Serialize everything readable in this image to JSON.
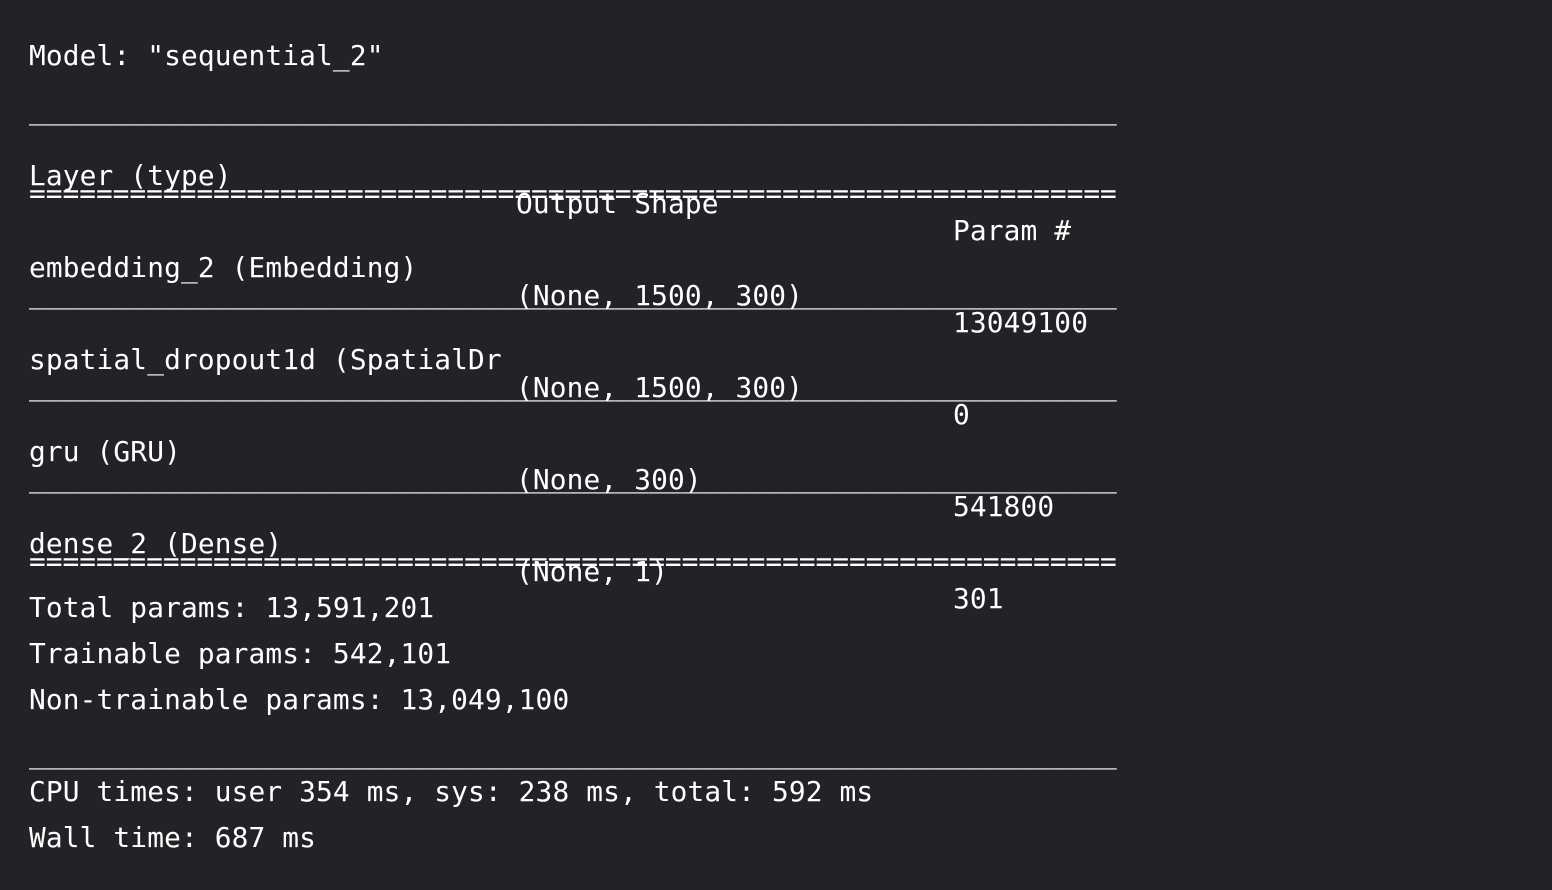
{
  "model_line": "Model: \"sequential_2\"",
  "separators": {
    "dash": "_________________________________________________________________",
    "equals": "================================================================="
  },
  "header": {
    "layer": "Layer (type)",
    "shape": "Output Shape",
    "param": "Param #"
  },
  "layers": [
    {
      "name": "embedding_2 (Embedding)",
      "shape": "(None, 1500, 300)",
      "params": "13049100"
    },
    {
      "name": "spatial_dropout1d (SpatialDr",
      "shape": "(None, 1500, 300)",
      "params": "0"
    },
    {
      "name": "gru (GRU)",
      "shape": "(None, 300)",
      "params": "541800"
    },
    {
      "name": "dense_2 (Dense)",
      "shape": "(None, 1)",
      "params": "301"
    }
  ],
  "summary": {
    "total": "Total params: 13,591,201",
    "trainable": "Trainable params: 542,101",
    "non_trainable": "Non-trainable params: 13,049,100"
  },
  "timing": {
    "cpu": "CPU times: user 354 ms, sys: 238 ms, total: 592 ms",
    "wall": "Wall time: 687 ms"
  }
}
